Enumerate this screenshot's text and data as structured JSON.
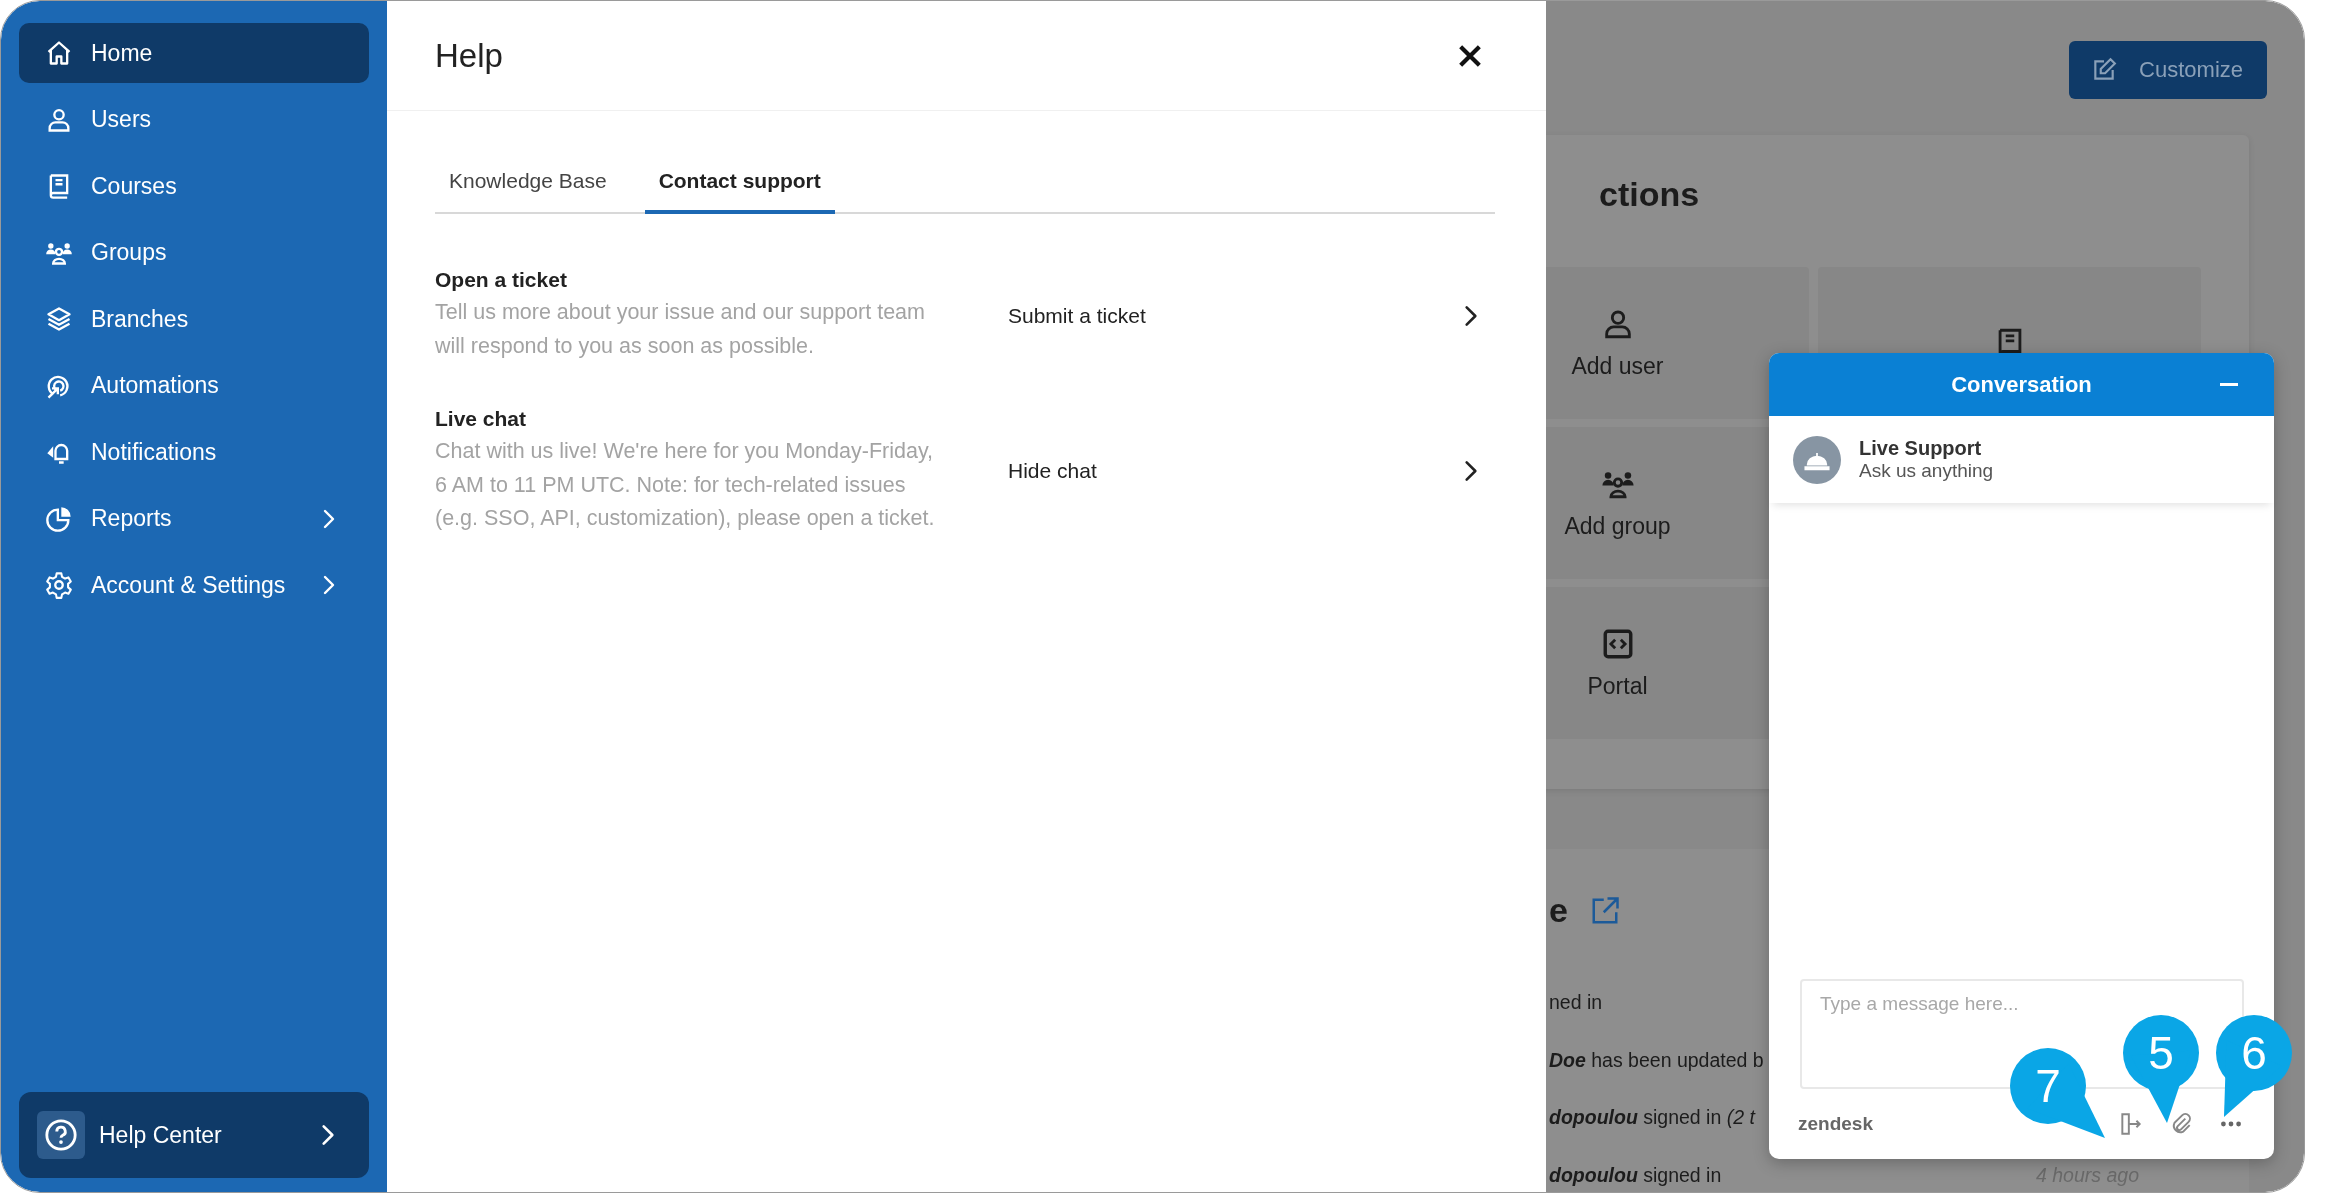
{
  "sidebar": {
    "items": [
      {
        "label": "Home",
        "selected": true,
        "expandable": false
      },
      {
        "label": "Users",
        "selected": false,
        "expandable": false
      },
      {
        "label": "Courses",
        "selected": false,
        "expandable": false
      },
      {
        "label": "Groups",
        "selected": false,
        "expandable": false
      },
      {
        "label": "Branches",
        "selected": false,
        "expandable": false
      },
      {
        "label": "Automations",
        "selected": false,
        "expandable": false
      },
      {
        "label": "Notifications",
        "selected": false,
        "expandable": false
      },
      {
        "label": "Reports",
        "selected": false,
        "expandable": true
      },
      {
        "label": "Account & Settings",
        "selected": false,
        "expandable": true
      }
    ],
    "help_center": {
      "label": "Help Center"
    }
  },
  "help_panel": {
    "title": "Help",
    "tabs": [
      {
        "label": "Knowledge Base",
        "selected": false
      },
      {
        "label": "Contact support",
        "selected": true
      }
    ],
    "sections": [
      {
        "title": "Open a ticket",
        "description": "Tell us more about your issue and our support team will respond to you as soon as possible.",
        "action": "Submit a ticket"
      },
      {
        "title": "Live chat",
        "description": "Chat with us live! We're here for you Monday-Friday, 6 AM to 11 PM UTC. Note: for tech-related issues (e.g. SSO, API, customization), please open a ticket.",
        "action": "Hide chat"
      }
    ]
  },
  "background": {
    "customize_button": "Customize",
    "card_title": "ctions",
    "tiles": [
      {
        "label": "Add user"
      },
      {
        "label": "Add group"
      },
      {
        "label": "Portal"
      }
    ],
    "section_title": "e",
    "activity": [
      {
        "text": "ned in"
      },
      {
        "text": "**Doe** has been updated b"
      },
      {
        "text": "**dopoulou** signed in *(2 t*"
      },
      {
        "text": "**dopoulou** signed in",
        "time": "4 hours ago"
      }
    ]
  },
  "chat": {
    "title": "Conversation",
    "agent": {
      "name": "Live Support",
      "status": "Ask us anything"
    },
    "input": {
      "placeholder": "Type a message here..."
    },
    "brand": "zendesk",
    "callouts": [
      {
        "number": "7"
      },
      {
        "number": "5"
      },
      {
        "number": "6"
      }
    ]
  }
}
